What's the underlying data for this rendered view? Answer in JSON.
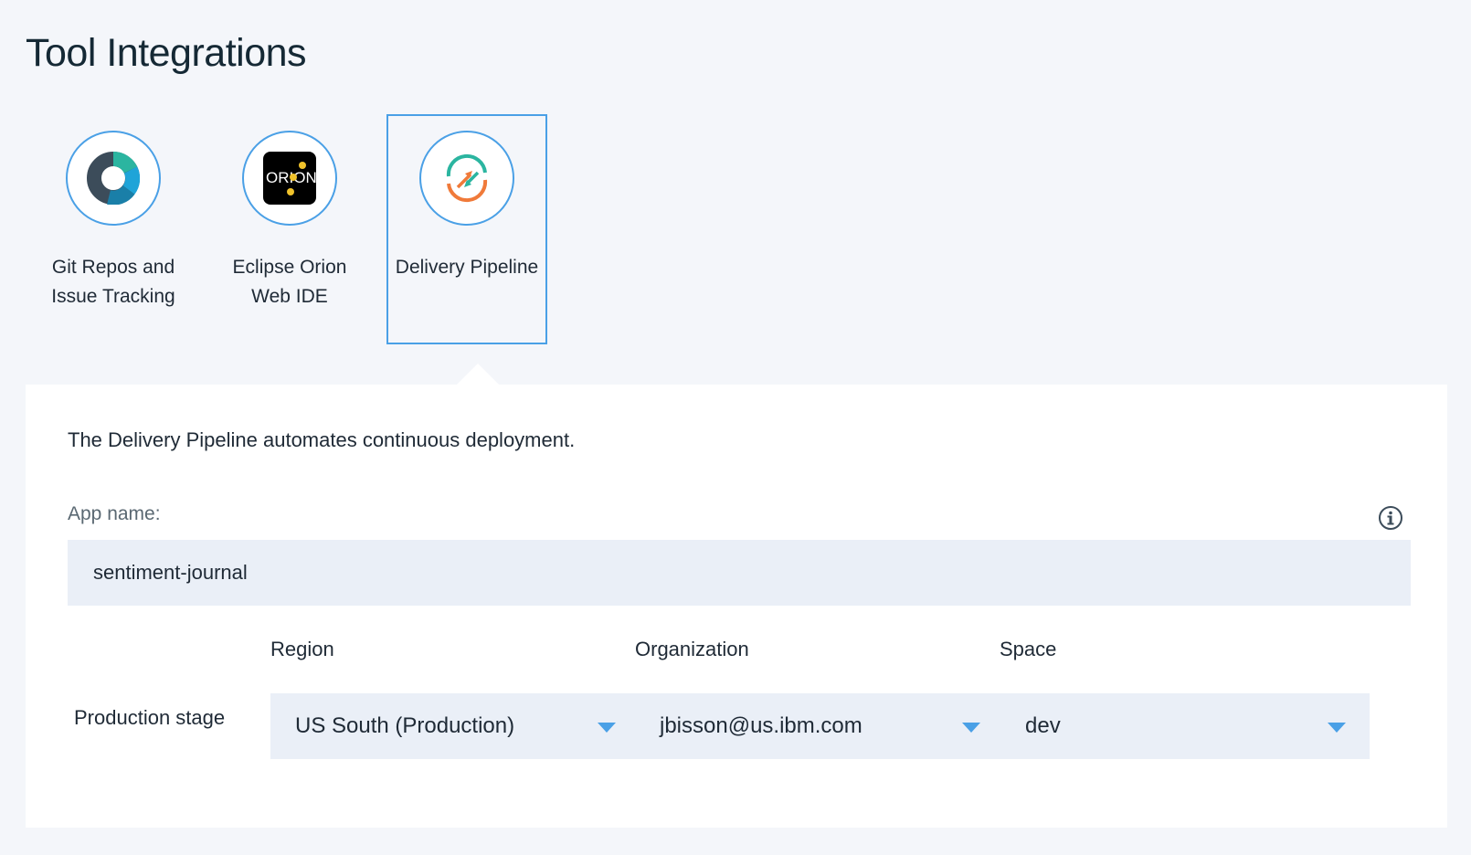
{
  "page": {
    "title": "Tool Integrations"
  },
  "tools": [
    {
      "label": "Git Repos and Issue Tracking",
      "icon": "git-repos-icon",
      "selected": false
    },
    {
      "label": "Eclipse Orion Web IDE",
      "icon": "orion-icon",
      "logo_text": "ORION",
      "selected": false
    },
    {
      "label": "Delivery Pipeline",
      "icon": "delivery-pipeline-icon",
      "selected": true
    }
  ],
  "panel": {
    "description": "The Delivery Pipeline automates continuous deployment.",
    "app_name_label": "App name:",
    "app_name_value": "sentiment-journal",
    "columns": {
      "region": "Region",
      "organization": "Organization",
      "space": "Space"
    },
    "stage_label": "Production stage",
    "region_value": "US South (Production)",
    "organization_value": "jbisson@us.ibm.com",
    "space_value": "dev"
  },
  "colors": {
    "accent": "#4aa0e6",
    "background": "#f4f6fa",
    "field_background": "#eaeff7"
  }
}
